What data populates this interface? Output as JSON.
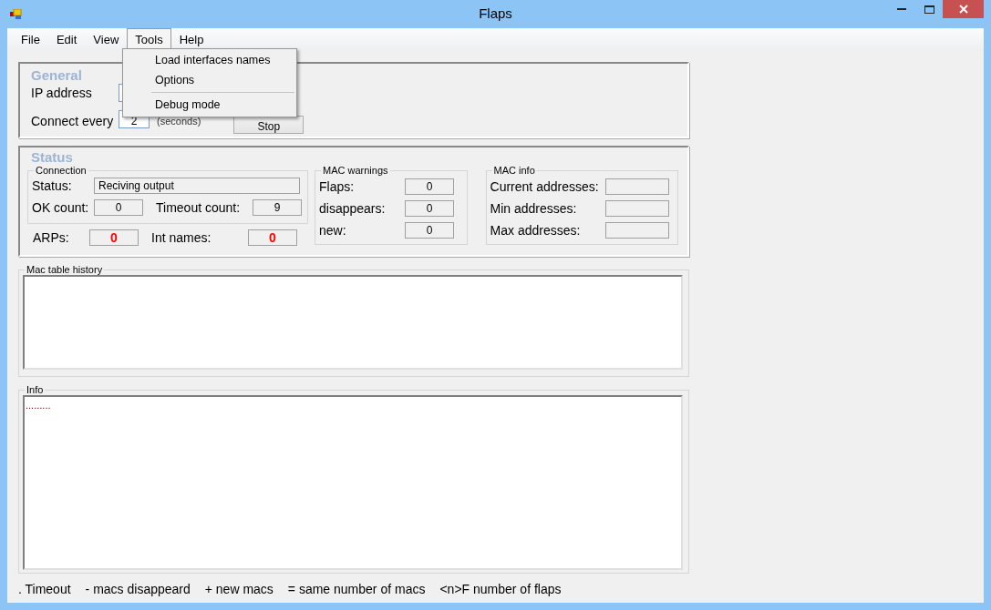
{
  "window": {
    "title": "Flaps"
  },
  "menu_bar": [
    {
      "label": "File",
      "selected": false
    },
    {
      "label": "Edit",
      "selected": false
    },
    {
      "label": "View",
      "selected": false
    },
    {
      "label": "Tools",
      "selected": true
    },
    {
      "label": "Help",
      "selected": false
    }
  ],
  "tools_menu": [
    {
      "kind": "item",
      "label": "Load interfaces names"
    },
    {
      "kind": "item",
      "label": "Options"
    },
    {
      "kind": "separator"
    },
    {
      "kind": "item",
      "label": "Debug mode"
    }
  ],
  "general": {
    "title": "General",
    "ip_label": "IP address",
    "connect_label": "Connect every",
    "interval": "2",
    "unit": "(seconds)",
    "stop_button": "Stop"
  },
  "status": {
    "title": "Status",
    "connection": {
      "title": "Connection",
      "status_label": "Status:",
      "status_value": "Reciving output",
      "counts": [
        {
          "label": "OK count:",
          "value": "0",
          "alert": false
        },
        {
          "label": "Timeout count:",
          "value": "9",
          "alert": false
        }
      ]
    },
    "extra": [
      {
        "label": "ARPs:",
        "value": "0",
        "alert": true
      },
      {
        "label": "Int names:",
        "value": "0",
        "alert": true
      }
    ],
    "mac_warnings": {
      "title": "MAC warnings",
      "rows": [
        {
          "label": "Flaps:",
          "value": "0"
        },
        {
          "label": "disappears:",
          "value": "0"
        },
        {
          "label": "new:",
          "value": "0"
        }
      ]
    },
    "mac_info": {
      "title": "MAC info",
      "rows": [
        {
          "label": "Current addresses:"
        },
        {
          "label": "Min addresses:"
        },
        {
          "label": "Max addresses:"
        }
      ]
    }
  },
  "mac_history": {
    "title": "Mac table  history"
  },
  "info": {
    "title": "Info",
    "text": "........."
  },
  "legend": [
    ". Timeout",
    "- macs disappeard",
    "+ new macs",
    "= same number of macs",
    "<n>F number of flaps"
  ]
}
